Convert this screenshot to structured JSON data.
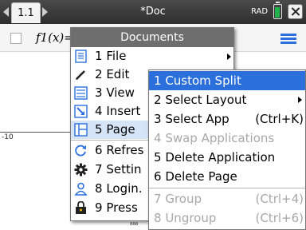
{
  "topbar": {
    "tab_label": "1.1",
    "doc_title": "*Doc",
    "angle_mode": "RAD",
    "battery_level": 0.8
  },
  "entry": {
    "function_label": "f1(x)="
  },
  "graph": {
    "x_min_label": "-10",
    "tick_fragment": "ᵟᵟᵟ"
  },
  "documents_menu": {
    "title": "Documents",
    "items": [
      {
        "number": "1",
        "label": "File",
        "icon": "file-icon"
      },
      {
        "number": "2",
        "label": "Edit",
        "icon": "pencil-icon"
      },
      {
        "number": "3",
        "label": "View",
        "icon": "view-icon"
      },
      {
        "number": "4",
        "label": "Insert",
        "icon": "insert-icon"
      },
      {
        "number": "5",
        "label": "Page",
        "icon": "page-layout-icon"
      },
      {
        "number": "6",
        "label": "Refres",
        "icon": "refresh-icon"
      },
      {
        "number": "7",
        "label": "Settin",
        "icon": "settings-gear-icon"
      },
      {
        "number": "8",
        "label": "Login.",
        "icon": "user-icon"
      },
      {
        "number": "9",
        "label": "Press",
        "icon": "lock-icon"
      }
    ]
  },
  "page_menu": {
    "items": [
      {
        "number": "1",
        "label": "Custom Split",
        "shortcut": ""
      },
      {
        "number": "2",
        "label": "Select Layout",
        "shortcut": ""
      },
      {
        "number": "3",
        "label": "Select App",
        "shortcut": "(Ctrl+K)"
      },
      {
        "number": "4",
        "label": "Swap Applications",
        "shortcut": ""
      },
      {
        "number": "5",
        "label": "Delete Application",
        "shortcut": ""
      },
      {
        "number": "6",
        "label": "Delete Page",
        "shortcut": ""
      },
      {
        "number": "7",
        "label": "Group",
        "shortcut": "(Ctrl+4)"
      },
      {
        "number": "8",
        "label": "Ungroup",
        "shortcut": "(Ctrl+6)"
      }
    ]
  },
  "colors": {
    "selection": "#2a6fdb",
    "highlight": "#d6e4f7",
    "menu_header": "#6e6e6e",
    "battery": "#22b14c",
    "accent_icon": "#2b6fe0"
  }
}
